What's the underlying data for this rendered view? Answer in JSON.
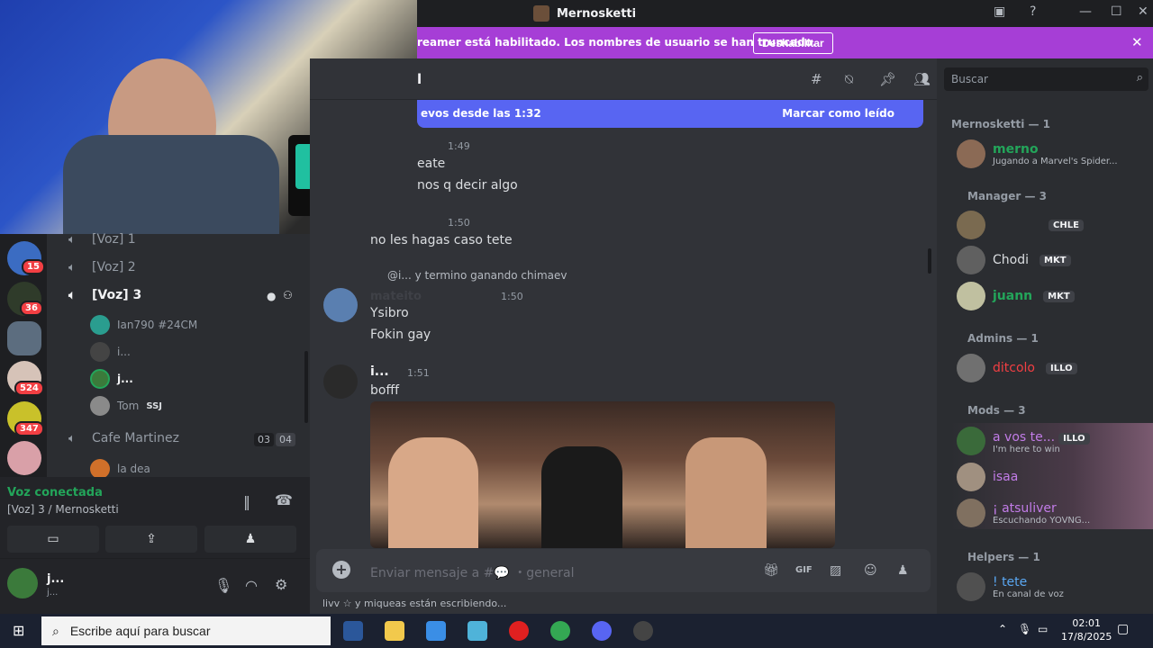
{
  "window": {
    "title": "Mernosketti"
  },
  "banner": {
    "text": "reamer está habilitado. Los nombres de usuario se han truncado.",
    "button": "Deshabilitar"
  },
  "channel_header": {
    "fragment": "l"
  },
  "new_messages": {
    "left": "evos desde las 1:32",
    "right": "Marcar como leído"
  },
  "channels": {
    "items": [
      {
        "name": "[Voz] 1"
      },
      {
        "name": "[Voz] 2"
      },
      {
        "name": "[Voz] 3"
      }
    ],
    "voice_users": [
      {
        "name": "Ian790 #24CM"
      },
      {
        "name": "i..."
      },
      {
        "name": "j..."
      },
      {
        "name": "Tom",
        "tag": "SSJ"
      }
    ],
    "cafe": {
      "name": "Cafe Martinez",
      "count_a": "03",
      "count_b": "04"
    },
    "cafe_user": "la dea"
  },
  "server_badges": [
    "15",
    "36",
    "524",
    "347"
  ],
  "voice_panel": {
    "status": "Voz conectada",
    "location": "[Voz] 3 / Mernosketti"
  },
  "user_panel": {
    "name": "j...",
    "sub": "j..."
  },
  "messages": [
    {
      "time": "1:49",
      "lines": [
        "eate",
        "nos q decir algo"
      ]
    },
    {
      "time": "1:50",
      "lines": [
        "no les hagas caso tete"
      ]
    },
    {
      "reply": "@i... y termino ganando chimaev",
      "author": "mateito",
      "time": "1:50",
      "lines": [
        "Ysibro",
        "Fokin gay"
      ]
    },
    {
      "author": "i...",
      "time": "1:51",
      "lines": [
        "bofff"
      ]
    }
  ],
  "composer": {
    "placeholder": "Enviar mensaje a #💬 ・general"
  },
  "typing": "livv ☆ y miqueas están escribiendo...",
  "search": {
    "placeholder": "Buscar"
  },
  "members": {
    "groups": [
      {
        "label": "Mernosketti — 1"
      },
      {
        "label": "Manager — 3"
      },
      {
        "label": "Admins — 1"
      },
      {
        "label": "Mods — 3"
      },
      {
        "label": "Helpers — 1"
      }
    ],
    "list": [
      {
        "name": "merno",
        "status": "Jugando a Marvel's Spider...",
        "color": "#23a55a"
      },
      {
        "name": "",
        "pill": "CHLE",
        "color": "#f23f43"
      },
      {
        "name": "Chodi",
        "pill": "MKT",
        "color": "#dbdee1"
      },
      {
        "name": "juann",
        "pill": "MKT",
        "color": "#23a55a"
      },
      {
        "name": "ditcolo",
        "pill": "ILLO",
        "color": "#f23f43"
      },
      {
        "name": "a vos te...",
        "pill": "ILLO",
        "status": "I'm here to win",
        "color": "#c27ce8"
      },
      {
        "name": "isaa",
        "color": "#c27ce8"
      },
      {
        "name": "¡ atsuliver",
        "status": "Escuchando YOVNG...",
        "color": "#c27ce8"
      },
      {
        "name": "! tete",
        "status": "En canal de voz",
        "color": "#5aa7f2"
      }
    ]
  },
  "taskbar": {
    "search_placeholder": "Escribe aquí para buscar",
    "time": "02:01",
    "date": "17/8/2025"
  },
  "colors": {
    "accent": "#5865f2",
    "banner": "#a63ed6",
    "online": "#23a55a"
  }
}
